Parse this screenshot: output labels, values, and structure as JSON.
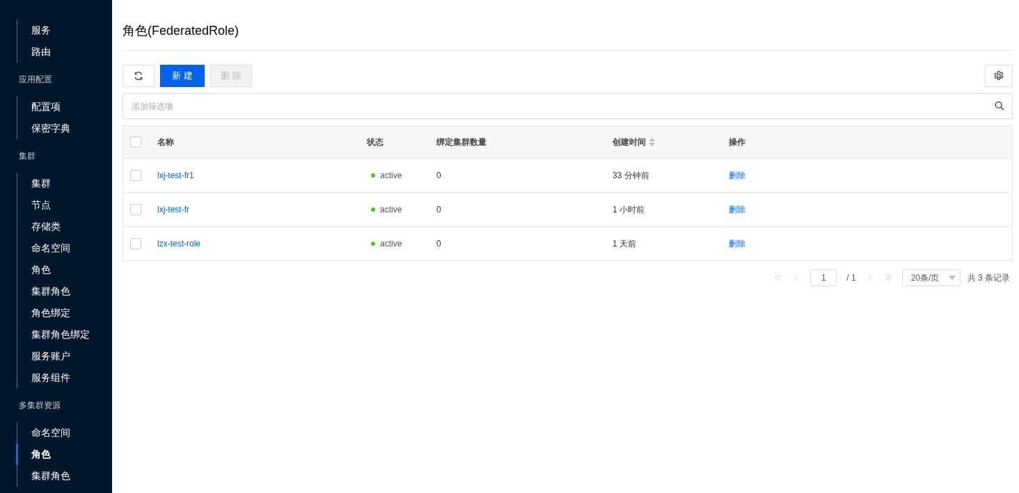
{
  "sidebar": {
    "groups": [
      {
        "items": [
          {
            "label": "服务",
            "selected": false
          },
          {
            "label": "路由",
            "selected": false
          }
        ]
      },
      {
        "heading": "应用配置",
        "items": [
          {
            "label": "配置项",
            "selected": false
          },
          {
            "label": "保密字典",
            "selected": false
          }
        ]
      },
      {
        "heading": "集群",
        "items": [
          {
            "label": "集群",
            "selected": false
          },
          {
            "label": "节点",
            "selected": false
          },
          {
            "label": "存储类",
            "selected": false
          },
          {
            "label": "命名空间",
            "selected": false
          },
          {
            "label": "角色",
            "selected": false
          },
          {
            "label": "集群角色",
            "selected": false
          },
          {
            "label": "角色绑定",
            "selected": false
          },
          {
            "label": "集群角色绑定",
            "selected": false
          },
          {
            "label": "服务账户",
            "selected": false
          },
          {
            "label": "服务组件",
            "selected": false
          }
        ]
      },
      {
        "heading": "多集群资源",
        "items": [
          {
            "label": "命名空间",
            "selected": false
          },
          {
            "label": "角色",
            "selected": true
          },
          {
            "label": "集群角色",
            "selected": false
          }
        ]
      }
    ]
  },
  "page_title": "角色(FederatedRole)",
  "toolbar": {
    "buttons": [
      {
        "kind": "refresh",
        "disabled": false
      },
      {
        "kind": "primary",
        "label": "新 建",
        "disabled": false
      },
      {
        "kind": "default",
        "label": "删 除",
        "disabled": true
      }
    ]
  },
  "search": {
    "placeholder": "添加筛选项"
  },
  "table": {
    "all_checked": false,
    "columns": [
      {
        "label": "名称",
        "sortable": false
      },
      {
        "label": "状态",
        "sortable": false
      },
      {
        "label": "绑定集群数量",
        "sortable": false
      },
      {
        "label": "创建时间",
        "sortable": true
      },
      {
        "label": "操作",
        "sortable": false
      }
    ],
    "rows": [
      {
        "checked": false,
        "name": "lxj-test-fr1",
        "status": "active",
        "color": "#52c41a",
        "clusters": "0",
        "created": "33 分钟前",
        "action": "删除"
      },
      {
        "checked": false,
        "name": "lxj-test-fr",
        "status": "active",
        "color": "#52c41a",
        "clusters": "0",
        "created": "1 小时前",
        "action": "删除"
      },
      {
        "checked": false,
        "name": "lzx-test-role",
        "status": "active",
        "color": "#52c41a",
        "clusters": "0",
        "created": "1 天前",
        "action": "删除"
      }
    ]
  },
  "pagination": {
    "page": "1",
    "total_pages": "/ 1",
    "page_size": "20条/页",
    "total": "共 3 条记录"
  }
}
